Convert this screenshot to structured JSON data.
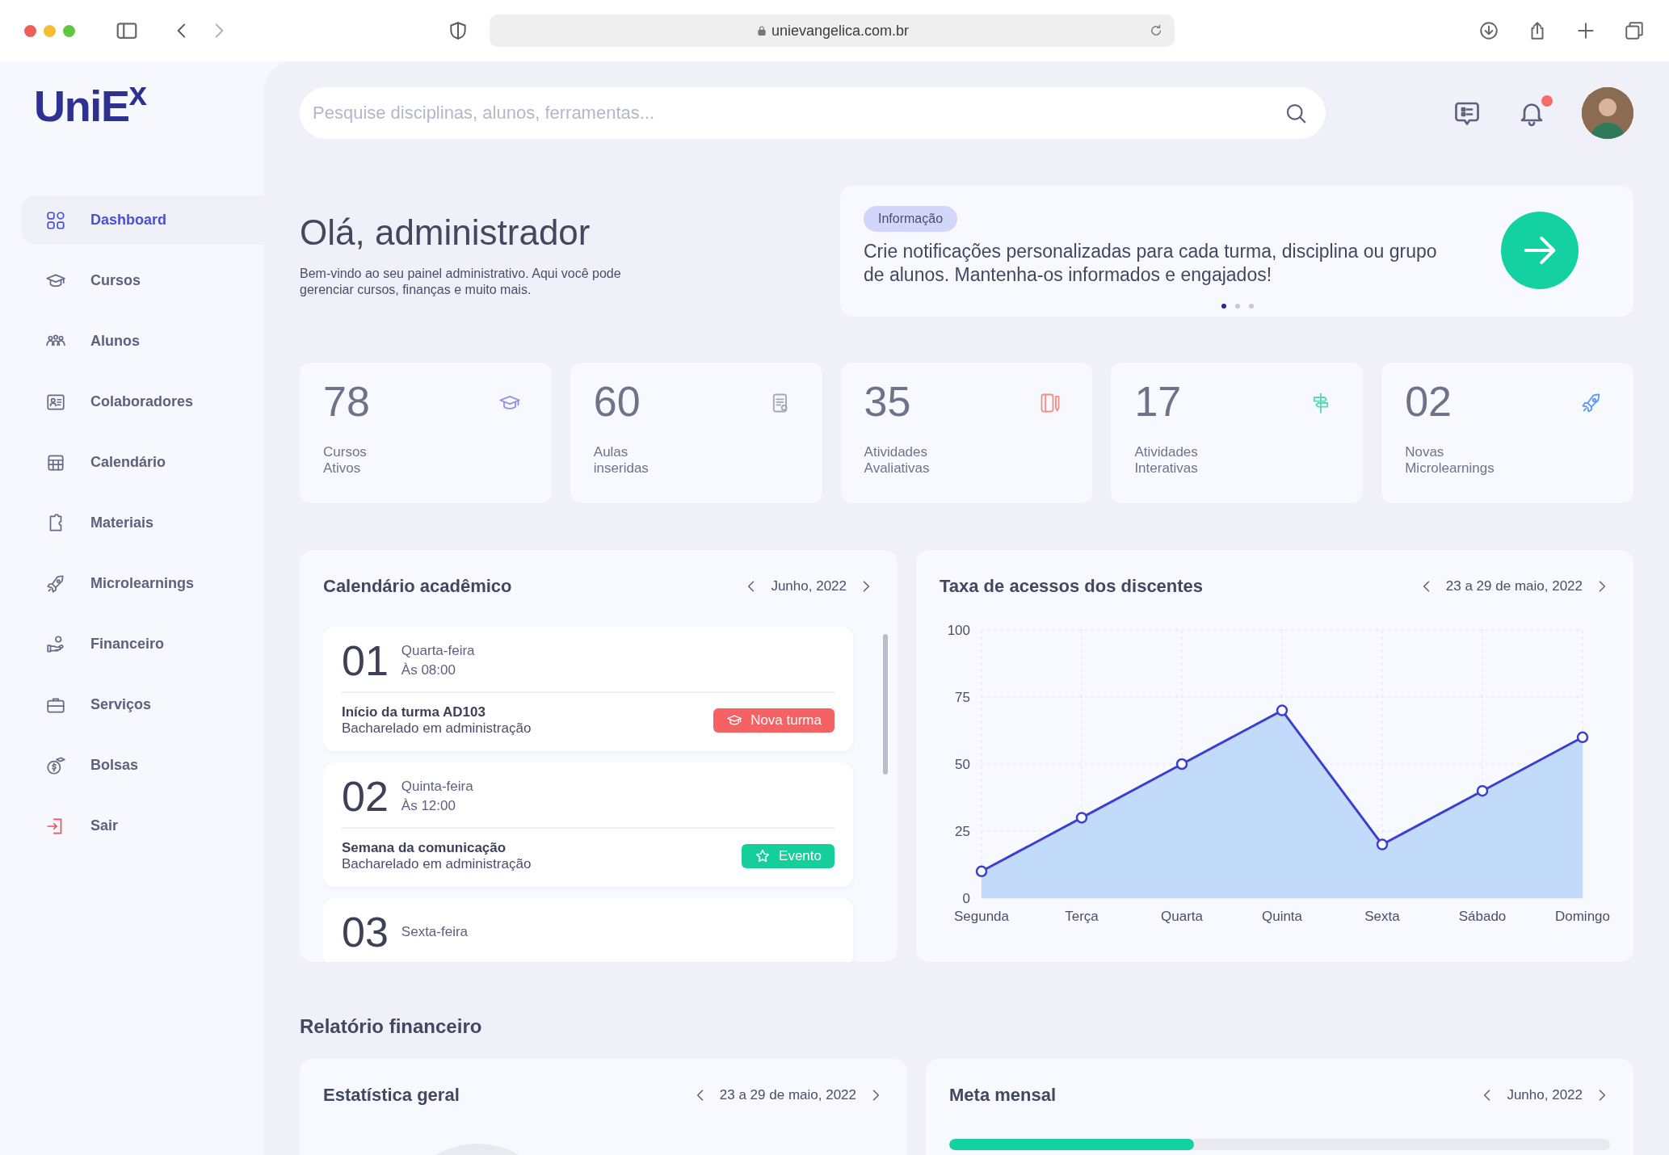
{
  "browser": {
    "url": "unievangelica.com.br"
  },
  "sidebar": {
    "logo": "UniE$^{x}$",
    "items": [
      {
        "label": "Dashboard",
        "kind": "link",
        "selected": true
      },
      {
        "label": "Cursos",
        "kind": "link",
        "selected": false
      },
      {
        "label": "Alunos",
        "kind": "link",
        "selected": false
      },
      {
        "label": "Colaboradores",
        "kind": "link",
        "selected": false
      },
      {
        "label": "Calendário",
        "kind": "link",
        "selected": false
      },
      {
        "label": "Materiais",
        "kind": "link",
        "selected": false
      },
      {
        "label": "Microlearnings",
        "kind": "link",
        "selected": false
      },
      {
        "label": "Financeiro",
        "kind": "link",
        "selected": false
      },
      {
        "label": "Serviços",
        "kind": "link",
        "selected": false
      },
      {
        "label": "Bolsas",
        "kind": "link",
        "selected": false
      },
      {
        "label": "Sair",
        "kind": "logout",
        "selected": false
      }
    ]
  },
  "header": {
    "search": {
      "placeholder": "Pesquise disciplinas, alunos, ferramentas..."
    },
    "notifications_unread": true
  },
  "greeting": {
    "title": "Olá, administrador",
    "subtitle": "Bem-vindo ao seu painel administrativo. Aqui você pode gerenciar cursos, finanças e muito mais."
  },
  "info_card": {
    "badge": "Informação",
    "text": "Crie notificações personalizadas para cada turma, disciplina ou grupo de alunos. Mantenha-os informados e engajados!",
    "dots": [
      {
        "selected": true
      },
      {
        "selected": false
      },
      {
        "selected": false
      }
    ]
  },
  "stats": [
    {
      "value": "78",
      "label": "Cursos\nAtivos",
      "color": "#8e92e6"
    },
    {
      "value": "60",
      "label": "Aulas\ninseridas",
      "color": "#a3a7ba"
    },
    {
      "value": "35",
      "label": "Atividades\nAvaliativas",
      "color": "#f58c8c"
    },
    {
      "value": "17",
      "label": "Atividades\nInterativas",
      "color": "#5cd8b2"
    },
    {
      "value": "02",
      "label": "Novas\nMicrolearnings",
      "color": "#5a9df2"
    }
  ],
  "calendar": {
    "title": "Calendário acadêmico",
    "period": "Junho, 2022",
    "events": [
      {
        "day": "01",
        "weekday": "Quarta-feira",
        "time": "Às 08:00",
        "title": "Início da turma AD103",
        "subtitle": "Bacharelado em administração",
        "tag": {
          "label": "Nova turma",
          "kind": "new_class"
        }
      },
      {
        "day": "02",
        "weekday": "Quinta-feira",
        "time": "Às 12:00",
        "title": "Semana da comunicação",
        "subtitle": "Bacharelado em administração",
        "tag": {
          "label": "Evento",
          "kind": "event"
        }
      },
      {
        "day": "03",
        "weekday": "Sexta-feira"
      }
    ]
  },
  "access_chart": {
    "title": "Taxa de acessos dos discentes",
    "period": "23 a 29 de maio, 2022",
    "chart_data": {
      "type": "area",
      "categories": [
        "Segunda",
        "Terça",
        "Quarta",
        "Quinta",
        "Sexta",
        "Sábado",
        "Domingo"
      ],
      "series": [
        {
          "color": "#3b3fd0",
          "values": [
            10,
            30,
            50,
            70,
            20,
            40,
            60
          ]
        }
      ],
      "ylim": [
        0,
        100
      ],
      "yticks": [
        0,
        25,
        50,
        75,
        100
      ],
      "grid": true
    }
  },
  "financial": {
    "title": "Relatório financeiro",
    "general": {
      "title": "Estatística geral",
      "period": "23 a 29 de maio, 2022"
    },
    "monthly_goal": {
      "title": "Meta mensal",
      "period": "Junho, 2022",
      "level": 0.37
    }
  }
}
